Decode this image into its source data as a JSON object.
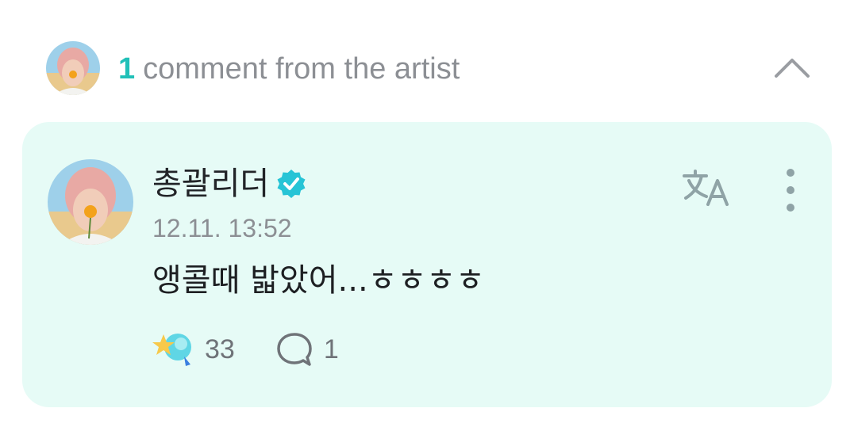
{
  "header": {
    "count": "1",
    "title": "comment from the artist",
    "avatar_icon": "artist-avatar",
    "collapse_icon": "chevron-up-icon"
  },
  "comment": {
    "author": "총괄리더",
    "verified_icon": "verified-badge-icon",
    "timestamp": "12.11. 13:52",
    "text": "앵콜때 밟았어...ㅎㅎㅎㅎ",
    "like_count": "33",
    "reply_count": "1",
    "translate_icon": "translate-icon",
    "more_icon": "more-vertical-icon"
  },
  "colors": {
    "accent": "#21c0b8",
    "card_bg": "#e6fbf6",
    "muted_text": "#8c8f94"
  }
}
